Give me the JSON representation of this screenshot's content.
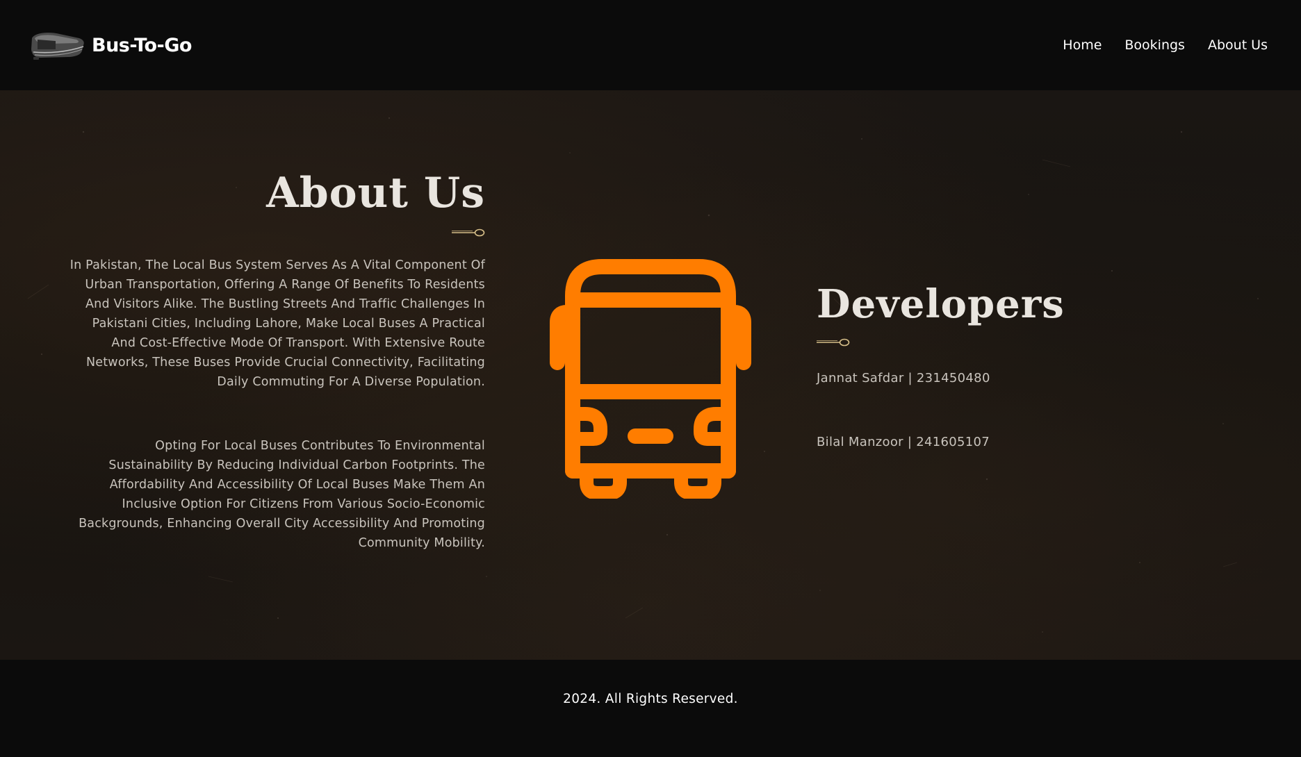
{
  "header": {
    "brand_name": "Bus-To-Go",
    "logo_icon": "bus-logo-icon",
    "nav": [
      {
        "label": "Home"
      },
      {
        "label": "Bookings"
      },
      {
        "label": "About Us"
      }
    ]
  },
  "about": {
    "title": "About Us",
    "paragraphs": [
      "In Pakistan, The Local Bus System Serves As A Vital Component Of Urban Transportation, Offering A Range Of Benefits To Residents And Visitors Alike. The Bustling Streets And Traffic Challenges In Pakistani Cities, Including Lahore, Make Local Buses A Practical And Cost-Effective Mode Of Transport. With Extensive Route Networks, These Buses Provide Crucial Connectivity, Facilitating Daily Commuting For A Diverse Population.",
      "Opting For Local Buses Contributes To Environmental Sustainability By Reducing Individual Carbon Footprints. The Affordability And Accessibility Of Local Buses Make Them An Inclusive Option For Citizens From Various Socio-Economic Backgrounds, Enhancing Overall City Accessibility And Promoting Community Mobility."
    ]
  },
  "illustration": {
    "icon": "bus-icon",
    "color": "#ff7d00"
  },
  "developers": {
    "title": "Developers",
    "items": [
      "Jannat Safdar | 231450480",
      "Bilal Manzoor | 241605107"
    ]
  },
  "footer": {
    "copyright": "2024. All Rights Reserved."
  },
  "colors": {
    "background": "#0b0b0b",
    "accent": "#ff7d00",
    "divider": "#d8c08a",
    "heading": "#e9e5df",
    "body_text": "#c9c4bd"
  }
}
